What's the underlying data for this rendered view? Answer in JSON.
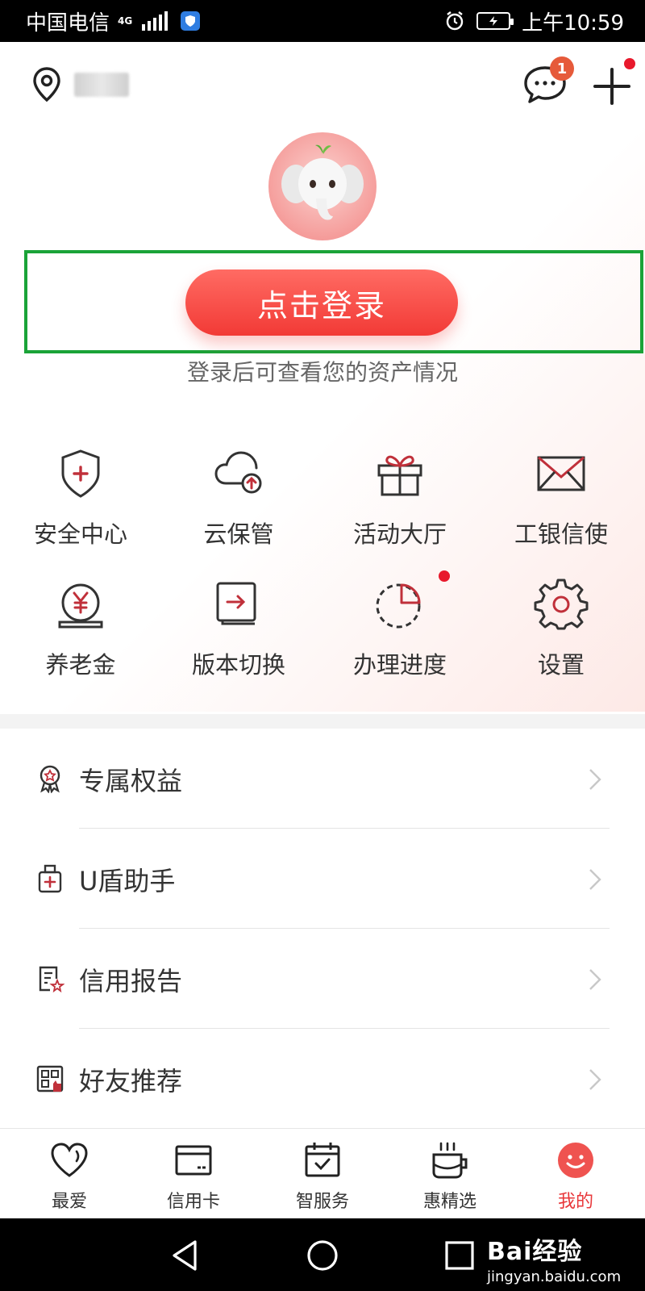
{
  "status_bar": {
    "carrier": "中国电信",
    "network": "4G",
    "time": "上午10:59"
  },
  "header": {
    "location_icon": "location-pin-icon",
    "message_icon": "chat-bubble-icon",
    "message_badge": "1",
    "add_icon": "plus-icon"
  },
  "login": {
    "button_label": "点击登录",
    "hint": "登录后可查看您的资产情况"
  },
  "quick_actions": [
    {
      "label": "安全中心",
      "icon": "shield-plus-icon"
    },
    {
      "label": "云保管",
      "icon": "cloud-upload-icon"
    },
    {
      "label": "活动大厅",
      "icon": "gift-icon"
    },
    {
      "label": "工银信使",
      "icon": "envelope-icon"
    },
    {
      "label": "养老金",
      "icon": "yuan-coin-icon"
    },
    {
      "label": "版本切换",
      "icon": "switch-arrow-icon"
    },
    {
      "label": "办理进度",
      "icon": "progress-pie-icon"
    },
    {
      "label": "设置",
      "icon": "gear-icon"
    }
  ],
  "menu_list": [
    {
      "label": "专属权益",
      "icon": "medal-icon"
    },
    {
      "label": "U盾助手",
      "icon": "usb-key-icon"
    },
    {
      "label": "信用报告",
      "icon": "report-icon"
    },
    {
      "label": "好友推荐",
      "icon": "qr-share-icon"
    }
  ],
  "tab_bar": [
    {
      "label": "最爱",
      "icon": "heart-icon",
      "active": false
    },
    {
      "label": "信用卡",
      "icon": "credit-card-icon",
      "active": false
    },
    {
      "label": "智服务",
      "icon": "calendar-check-icon",
      "active": false
    },
    {
      "label": "惠精选",
      "icon": "coffee-cup-icon",
      "active": false
    },
    {
      "label": "我的",
      "icon": "smiley-icon",
      "active": true
    }
  ],
  "watermark": {
    "brand": "Bai经验",
    "url": "jingyan.baidu.com"
  },
  "colors": {
    "accent": "#f23a36",
    "highlight_frame": "#1aa338",
    "icon_accent": "#c0303a"
  }
}
